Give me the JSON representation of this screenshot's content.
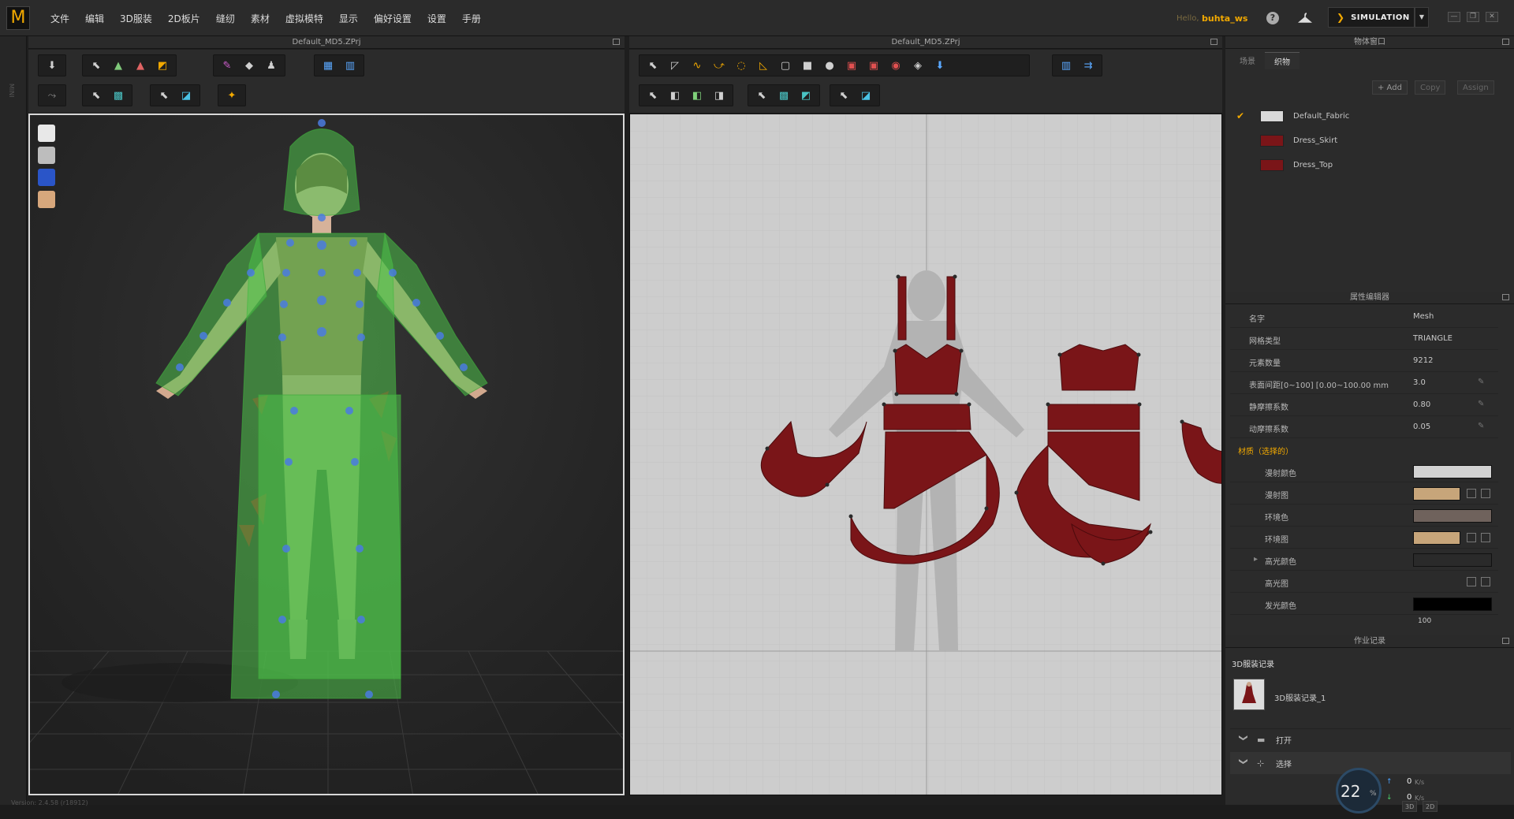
{
  "app": {
    "logo_letter": "M",
    "menu": [
      "文件",
      "编辑",
      "3D服装",
      "2D板片",
      "缝纫",
      "素材",
      "虚拟模特",
      "显示",
      "偏好设置",
      "设置",
      "手册"
    ],
    "hello": "Hello,",
    "username": "buhta_ws",
    "help": "?",
    "simulation_label": "SIMULATION",
    "simulation_chevron": "❯",
    "dropdown_arrow": "▼",
    "mini_label": "MINI"
  },
  "window_controls": [
    "—",
    "❐",
    "✕"
  ],
  "viewport3d": {
    "title": "Default_MD5.ZPrj"
  },
  "viewport2d": {
    "title": "Default_MD5.ZPrj"
  },
  "object_browser": {
    "title": "物体窗口",
    "tabs": [
      "场景",
      "织物"
    ],
    "active_tab": "织物",
    "buttons": [
      "+ Add",
      "Copy",
      "Assign"
    ],
    "fabrics": [
      {
        "name": "Default_Fabric",
        "color": "#d8d8d8",
        "checked": "✔"
      },
      {
        "name": "Dress_Skirt",
        "color": "#7a1518",
        "checked": ""
      },
      {
        "name": "Dress_Top",
        "color": "#7a1518",
        "checked": ""
      }
    ]
  },
  "property_editor": {
    "title": "属性编辑器",
    "rows": [
      {
        "label": "名字",
        "value": "Mesh"
      },
      {
        "label": "网格类型",
        "value": "TRIANGLE"
      },
      {
        "label": "元素数量",
        "value": "9212"
      },
      {
        "label": "表面间距[0~100] [0.00~100.00 mm",
        "value": "3.0"
      },
      {
        "label": "静摩擦系数",
        "value": "0.80"
      },
      {
        "label": "动摩擦系数",
        "value": "0.05"
      }
    ],
    "material_section": "材质（选择的）",
    "material_rows": [
      {
        "label": "漫射颜色",
        "swatch": "#d2d2d2"
      },
      {
        "label": "漫射图",
        "swatch": "#c7a57a"
      },
      {
        "label": "环境色",
        "swatch": "#6f625c"
      },
      {
        "label": "环境图",
        "swatch": "#c7a57a"
      },
      {
        "label": "高光颜色",
        "swatch": "#2a2a2a"
      },
      {
        "label": "高光图",
        "swatch": ""
      },
      {
        "label": "发光颜色",
        "swatch": "#000000"
      }
    ],
    "trailing_value": "100"
  },
  "history": {
    "title": "作业记录",
    "section_title": "3D服装记录",
    "entry_label": "3D服装记录_1",
    "rows": [
      "打开",
      "选择"
    ]
  },
  "status": {
    "version": "Version: 2.4.58    (r18912)",
    "perf_value": "22",
    "perf_unit": "%",
    "up_value": "0",
    "down_value": "0",
    "net_unit": "K/s",
    "view_3d": "3D",
    "view_2d": "2D"
  },
  "icons": {
    "arrow_up": "↑",
    "arrow_down": "↓",
    "chevron": "❯",
    "tree_arrow": "▸",
    "pen": "✎"
  },
  "colors": {
    "accent": "#f2a900",
    "fabric_red": "#7a1518",
    "avatar_green": "#4fc34a"
  }
}
